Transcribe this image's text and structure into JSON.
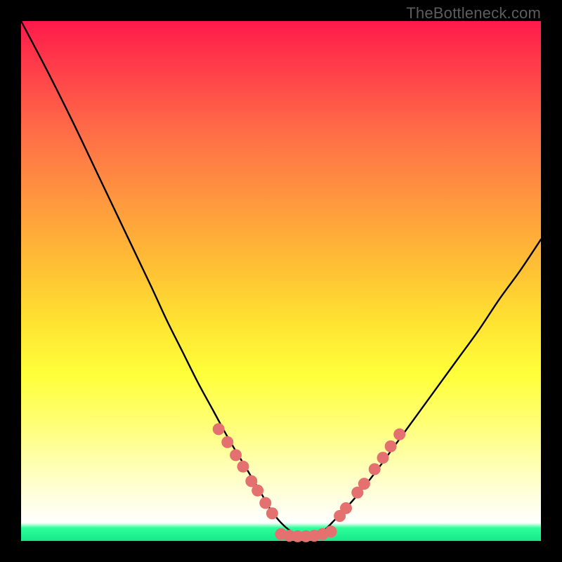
{
  "watermark": "TheBottleneck.com",
  "chart_data": {
    "type": "line",
    "title": "",
    "xlabel": "",
    "ylabel": "",
    "xlim": [
      0,
      100
    ],
    "ylim": [
      0,
      100
    ],
    "series": [
      {
        "name": "curve",
        "x": [
          0,
          5,
          10,
          15,
          20,
          25,
          28,
          31,
          34,
          37,
          40,
          43,
          46,
          48,
          50,
          52,
          54,
          56,
          58,
          60,
          64,
          68,
          72,
          76,
          80,
          84,
          88,
          92,
          96,
          100
        ],
        "y": [
          100,
          90.5,
          80.5,
          70,
          59.5,
          49,
          42.5,
          36.5,
          30.5,
          25,
          19.5,
          14.5,
          9.5,
          6,
          3.5,
          1.8,
          1,
          1,
          1.8,
          3.7,
          8,
          13,
          18.5,
          24,
          29.5,
          35,
          40.5,
          46.5,
          52,
          58
        ]
      }
    ],
    "markers": [
      {
        "x": 38,
        "y": 21.5
      },
      {
        "x": 39.7,
        "y": 19
      },
      {
        "x": 41.3,
        "y": 16.5
      },
      {
        "x": 42.7,
        "y": 14.3
      },
      {
        "x": 44.3,
        "y": 11.5
      },
      {
        "x": 45.5,
        "y": 9.7
      },
      {
        "x": 47,
        "y": 7.3
      },
      {
        "x": 48.3,
        "y": 5.3
      },
      {
        "x": 50,
        "y": 1.3
      },
      {
        "x": 51.6,
        "y": 1.0
      },
      {
        "x": 53.2,
        "y": 0.9
      },
      {
        "x": 54.8,
        "y": 0.9
      },
      {
        "x": 56.4,
        "y": 1.0
      },
      {
        "x": 58,
        "y": 1.3
      },
      {
        "x": 59.6,
        "y": 1.8
      },
      {
        "x": 61.3,
        "y": 4.8
      },
      {
        "x": 62.5,
        "y": 6.3
      },
      {
        "x": 64.7,
        "y": 9.3
      },
      {
        "x": 66,
        "y": 11
      },
      {
        "x": 68,
        "y": 13.8
      },
      {
        "x": 69.6,
        "y": 16
      },
      {
        "x": 71.1,
        "y": 18.2
      },
      {
        "x": 72.8,
        "y": 20.5
      }
    ],
    "marker_color": "#e4706f",
    "curve_color": "#000000"
  }
}
